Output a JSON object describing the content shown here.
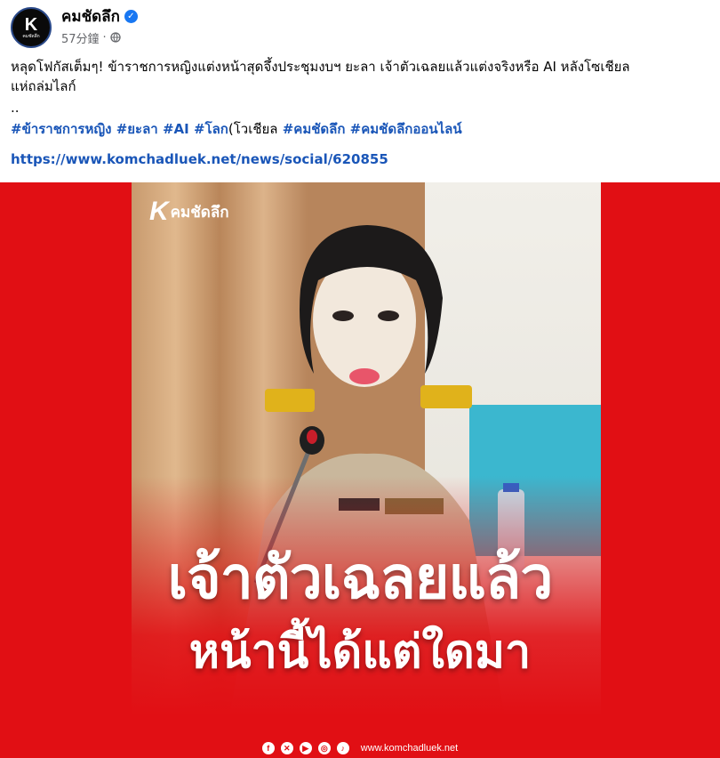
{
  "post": {
    "page_name": "คมชัดลึก",
    "avatar_letter": "K",
    "avatar_sub": "คมชัดลึก",
    "verified_icon": "verified-badge-icon",
    "timestamp": "57分鐘",
    "separator": "·",
    "audience_icon": "globe-icon"
  },
  "body": {
    "line1": "หลุดโฟกัสเต็มๆ! ข้าราชการหญิงแต่งหน้าสุดจึ้งประชุมงบฯ ยะลา เจ้าตัวเฉลยแล้วแต่งจริงหรือ AI หลังโซเชียล",
    "line2": "แห่ถล่มไลก์",
    "dots": "..",
    "hashtags": [
      "#ข้าราชการหญิง",
      "#ยะลา",
      "#AI",
      "#โลก"
    ],
    "hashtag_plain": "(โวเชียล",
    "hashtags2": [
      "#คมชัดลึก",
      "#คมชัดลึกออนไลน์"
    ],
    "link": "https://www.komchadluek.net/news/social/620855"
  },
  "media": {
    "logo_letter": "K",
    "logo_text": "คมชัดลึก",
    "headline_1": "เจ้าตัวเฉลยแล้ว",
    "headline_2": "หน้านี้ได้แต่ใดมา",
    "social_icons": [
      "facebook-icon",
      "x-icon",
      "youtube-icon",
      "instagram-icon",
      "tiktok-icon"
    ],
    "footer_url": "www.komchadluek.net",
    "background_color": "#e10f14"
  },
  "colors": {
    "link": "#1a56b8",
    "meta": "#65676b",
    "brand_red": "#e10f14",
    "verified": "#1877f2"
  }
}
